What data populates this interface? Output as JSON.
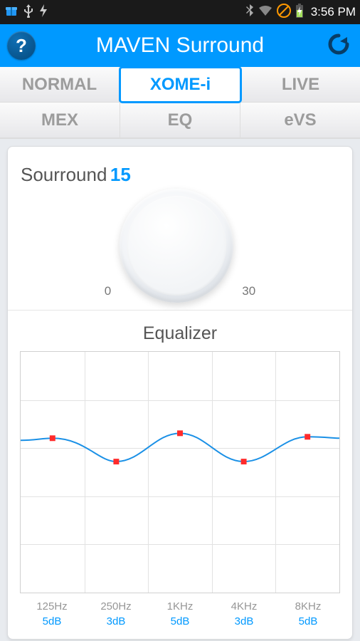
{
  "statusbar": {
    "clock": "3:56 PM"
  },
  "header": {
    "title": "MAVEN Surround",
    "help_label": "?",
    "icons": {
      "help": "help-circle-icon",
      "reload": "reload-icon"
    }
  },
  "tabs_row1": [
    {
      "label": "NORMAL",
      "active": false
    },
    {
      "label": "XOME-i",
      "active": true
    },
    {
      "label": "LIVE",
      "active": false
    }
  ],
  "tabs_row2": [
    {
      "label": "MEX",
      "active": false
    },
    {
      "label": "EQ",
      "active": false
    },
    {
      "label": "eVS",
      "active": false
    }
  ],
  "surround": {
    "label": "Sourround",
    "value": "15",
    "min": "0",
    "max": "30"
  },
  "equalizer": {
    "title": "Equalizer",
    "bands": [
      {
        "freq": "125Hz",
        "db": "5dB"
      },
      {
        "freq": "250Hz",
        "db": "3dB"
      },
      {
        "freq": "1KHz",
        "db": "5dB"
      },
      {
        "freq": "4KHz",
        "db": "3dB"
      },
      {
        "freq": "8KHz",
        "db": "5dB"
      }
    ]
  },
  "chart_data": {
    "type": "line",
    "title": "Equalizer",
    "xlabel": "",
    "ylabel": "",
    "categories": [
      "125Hz",
      "250Hz",
      "1KHz",
      "4KHz",
      "8KHz"
    ],
    "values_db": [
      5,
      3,
      5,
      3,
      5
    ],
    "value_labels": [
      "5dB",
      "3dB",
      "5dB",
      "3dB",
      "5dB"
    ],
    "ylim_implied": [
      0,
      10
    ]
  },
  "colors": {
    "accent": "#0099ff",
    "point": "#ff2b2b",
    "curve": "#1a90e6"
  }
}
